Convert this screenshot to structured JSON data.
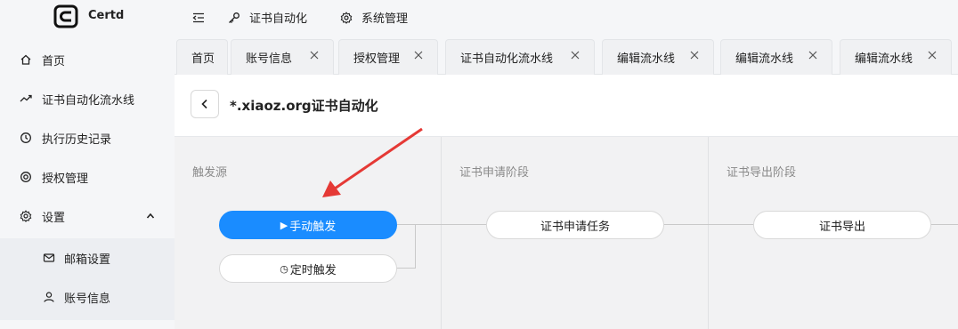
{
  "app": {
    "name": "Certd"
  },
  "topbar": {
    "collapse_icon": "menu-fold-icon",
    "links": [
      {
        "label": "证书自动化",
        "icon": "key-icon"
      },
      {
        "label": "系统管理",
        "icon": "gear-icon"
      }
    ]
  },
  "sidebar": {
    "items": [
      {
        "label": "首页",
        "icon": "home-icon"
      },
      {
        "label": "证书自动化流水线",
        "icon": "trend-icon"
      },
      {
        "label": "执行历史记录",
        "icon": "history-icon"
      },
      {
        "label": "授权管理",
        "icon": "target-icon"
      },
      {
        "label": "设置",
        "icon": "gear-icon",
        "expanded": true
      }
    ],
    "subitems": [
      {
        "label": "邮箱设置",
        "icon": "mail-icon"
      },
      {
        "label": "账号信息",
        "icon": "user-icon"
      }
    ]
  },
  "tabs": [
    {
      "label": "首页",
      "closable": false
    },
    {
      "label": "账号信息",
      "closable": true
    },
    {
      "label": "授权管理",
      "closable": true
    },
    {
      "label": "证书自动化流水线",
      "closable": true
    },
    {
      "label": "编辑流水线",
      "closable": true
    },
    {
      "label": "编辑流水线",
      "closable": true
    },
    {
      "label": "编辑流水线",
      "closable": true
    }
  ],
  "page": {
    "title": "*.xiaoz.org证书自动化"
  },
  "pipeline": {
    "stages": [
      {
        "title": "触发源",
        "nodes": [
          {
            "label": "手动触发",
            "icon": "play-icon",
            "glyph": "▶",
            "primary": true
          },
          {
            "label": "定时触发",
            "icon": "clock-icon",
            "glyph": "◷",
            "primary": false
          }
        ]
      },
      {
        "title": "证书申请阶段",
        "nodes": [
          {
            "label": "证书申请任务"
          }
        ]
      },
      {
        "title": "证书导出阶段",
        "nodes": [
          {
            "label": "证书导出"
          }
        ]
      }
    ]
  },
  "colors": {
    "primary": "#1a8cff",
    "annotation_arrow": "#e53935",
    "sidebar_bg": "#f5f6f8"
  }
}
